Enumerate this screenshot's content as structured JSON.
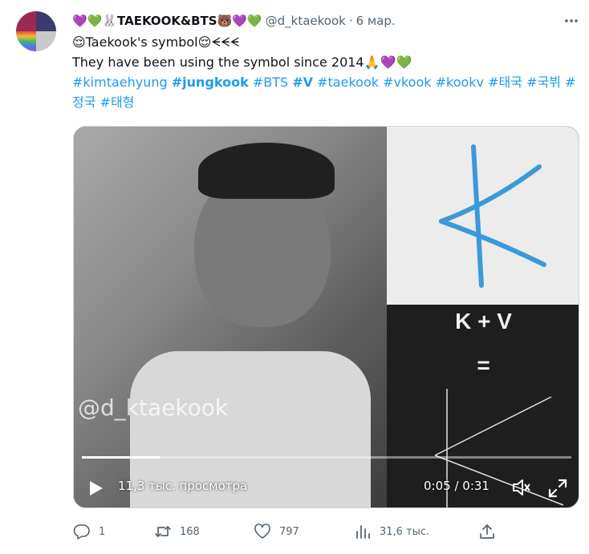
{
  "author": {
    "display_name": "💜💚🐰TAEKOOK&BTS🐻💜💚",
    "handle": "@d_ktaekook",
    "separator": "·",
    "time": "6 мар."
  },
  "tweet": {
    "line1": "😌Taekook's symbol😌ᗕᗕᗕ",
    "line2": "They have been using the symbol since 2014🙏💜💚",
    "hashtags": [
      {
        "text": "#kimtaehyung",
        "bold": false
      },
      {
        "text": "#jungkook",
        "bold": true
      },
      {
        "text": "#BTS",
        "bold": false
      },
      {
        "text": "#V",
        "bold": true
      },
      {
        "text": "#taekook",
        "bold": false
      },
      {
        "text": "#vkook",
        "bold": false
      },
      {
        "text": "#kookv",
        "bold": false
      },
      {
        "text": "#태국",
        "bold": false
      },
      {
        "text": "#국뷔",
        "bold": false
      },
      {
        "text": "#정국",
        "bold": false
      },
      {
        "text": "#태형",
        "bold": false
      }
    ]
  },
  "media": {
    "watermark": "@d_ktaekook",
    "panel_text_top": "K + V",
    "panel_text_eq": "=",
    "views": "11,3 тыс. просмотра",
    "timecode": "0:05 / 0:31",
    "progress_fraction": 0.161,
    "symbol_color": "#3a9ad9"
  },
  "actions": {
    "reply_count": "1",
    "retweet_count": "168",
    "like_count": "797",
    "views_count": "31,6 тыс."
  },
  "colors": {
    "accent": "#1d9bf0",
    "muted": "#536471"
  }
}
